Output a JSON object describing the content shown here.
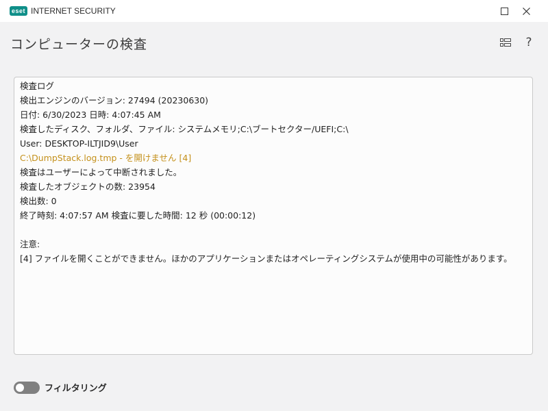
{
  "window": {
    "brand": "eset",
    "app_name": "INTERNET SECURITY",
    "maximize_icon": "maximize-icon",
    "close_icon": "close-icon"
  },
  "header": {
    "title": "コンピューターの検査",
    "list_icon": "list-view-icon",
    "help_label": "?"
  },
  "log": {
    "lines": [
      {
        "text": "検査ログ",
        "type": "normal"
      },
      {
        "text": "検出エンジンのバージョン: 27494 (20230630)",
        "type": "normal"
      },
      {
        "text": "日付: 6/30/2023  日時: 4:07:45 AM",
        "type": "normal"
      },
      {
        "text": "検査したディスク、フォルダ、ファイル: システムメモリ;C:\\ブートセクター/UEFI;C:\\",
        "type": "normal"
      },
      {
        "text": "User: DESKTOP-ILTJID9\\User",
        "type": "normal"
      },
      {
        "text": "C:\\DumpStack.log.tmp - を開けません [4]",
        "type": "warn"
      },
      {
        "text": "検査はユーザーによって中断されました。",
        "type": "normal"
      },
      {
        "text": "検査したオブジェクトの数: 23954",
        "type": "normal"
      },
      {
        "text": "検出数: 0",
        "type": "normal"
      },
      {
        "text": "終了時刻: 4:07:57 AM  検査に要した時間: 12 秒 (00:00:12)",
        "type": "normal"
      },
      {
        "text": "",
        "type": "blank"
      },
      {
        "text": "注意:",
        "type": "normal"
      },
      {
        "text": "[4] ファイルを開くことができません。ほかのアプリケーションまたはオペレーティングシステムが使用中の可能性があります。",
        "type": "normal"
      }
    ]
  },
  "filter": {
    "label": "フィルタリング",
    "enabled": false
  },
  "colors": {
    "brand": "#0f8f89",
    "warning_text": "#c4901a",
    "toggle_off": "#808080"
  }
}
